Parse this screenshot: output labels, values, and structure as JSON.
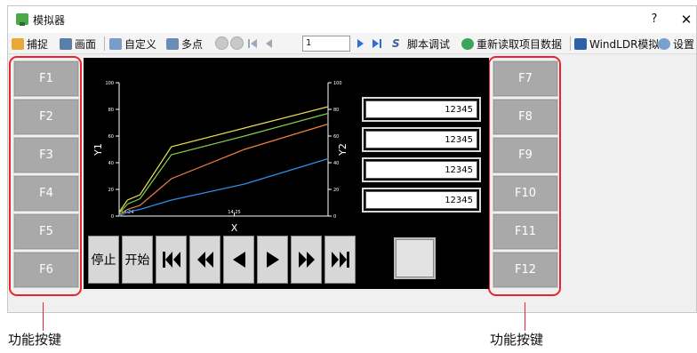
{
  "window": {
    "title": "模拟器",
    "help": "?",
    "close": "✕"
  },
  "toolbar": {
    "capture": "捕捉",
    "screen": "画面",
    "custom": "自定义",
    "multipoint": "多点",
    "frame_value": "1",
    "script_debug": "脚本调试",
    "reload": "重新读取项目数据",
    "windldr": "WindLDR模拟",
    "settings": "设置"
  },
  "left_keys": [
    "F1",
    "F2",
    "F3",
    "F4",
    "F5",
    "F6"
  ],
  "right_keys": [
    "F7",
    "F8",
    "F9",
    "F10",
    "F11",
    "F12"
  ],
  "values": [
    "12345",
    "12345",
    "12345",
    "12345"
  ],
  "controls": {
    "stop": "停止",
    "start": "开始"
  },
  "callouts": {
    "left": "功能按键",
    "right": "功能按键"
  },
  "chart_data": {
    "type": "line",
    "xlabel": "X",
    "ylabel": "Y1",
    "y2label": "Y2",
    "x_ticks": [
      "14:24",
      "14:25"
    ],
    "y_ticks": [
      0,
      20,
      40,
      60,
      80,
      100
    ],
    "ylim": [
      0,
      100
    ],
    "x": [
      0,
      0.04,
      0.1,
      0.25,
      0.6,
      1.0
    ],
    "series": [
      {
        "color": "#e8e050",
        "values": [
          3,
          12,
          16,
          52,
          66,
          82
        ]
      },
      {
        "color": "#7fd04a",
        "values": [
          2,
          9,
          13,
          46,
          60,
          77
        ]
      },
      {
        "color": "#f08040",
        "values": [
          1,
          5,
          8,
          28,
          50,
          69
        ]
      },
      {
        "color": "#2f8ef0",
        "values": [
          0,
          3,
          5,
          12,
          24,
          43
        ]
      }
    ]
  }
}
